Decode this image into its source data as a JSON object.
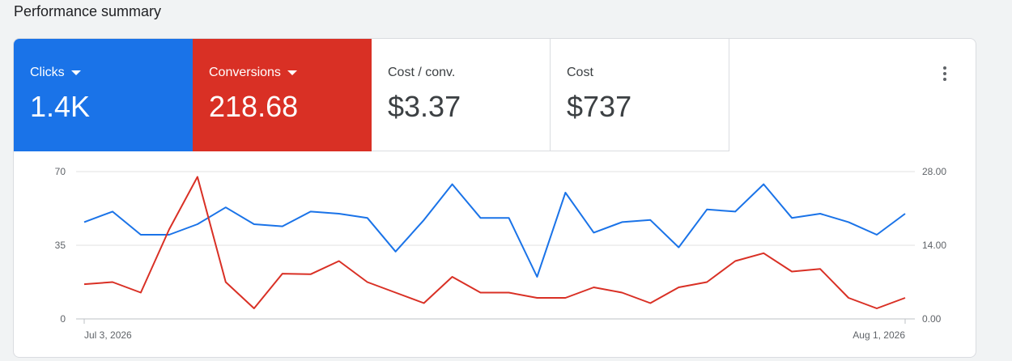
{
  "page": {
    "title": "Performance summary"
  },
  "metrics": [
    {
      "label": "Clicks",
      "value": "1.4K",
      "color": "#1a73e8",
      "has_dropdown": true
    },
    {
      "label": "Conversions",
      "value": "218.68",
      "color": "#d93025",
      "has_dropdown": true
    },
    {
      "label": "Cost / conv.",
      "value": "$3.37",
      "has_dropdown": false
    },
    {
      "label": "Cost",
      "value": "$737",
      "has_dropdown": false
    }
  ],
  "more_button": {
    "icon": "more-vert-icon"
  },
  "chart_data": {
    "type": "line",
    "x_tick_labels": [
      "Jul 3, 2026",
      "Aug 1, 2026"
    ],
    "x": [
      "2026-07-03",
      "2026-07-04",
      "2026-07-05",
      "2026-07-06",
      "2026-07-07",
      "2026-07-08",
      "2026-07-09",
      "2026-07-10",
      "2026-07-11",
      "2026-07-12",
      "2026-07-13",
      "2026-07-14",
      "2026-07-15",
      "2026-07-16",
      "2026-07-17",
      "2026-07-18",
      "2026-07-19",
      "2026-07-20",
      "2026-07-21",
      "2026-07-22",
      "2026-07-23",
      "2026-07-24",
      "2026-07-25",
      "2026-07-26",
      "2026-07-27",
      "2026-07-28",
      "2026-07-29",
      "2026-07-30",
      "2026-07-31",
      "2026-08-01"
    ],
    "series": [
      {
        "name": "Clicks",
        "axis": "left",
        "color": "#1a73e8",
        "values": [
          46,
          51,
          40,
          40,
          45,
          53,
          45,
          44,
          51,
          50,
          48,
          32,
          47,
          64,
          48,
          48,
          20,
          60,
          41,
          46,
          47,
          34,
          52,
          51,
          64,
          48,
          50,
          46,
          40,
          50
        ]
      },
      {
        "name": "Conversions",
        "axis": "right",
        "color": "#d93025",
        "values": [
          6.6,
          7.0,
          5.0,
          17.0,
          27.0,
          7.0,
          2.0,
          8.6,
          8.5,
          11.0,
          7.0,
          5.0,
          3.0,
          8.0,
          5.0,
          5.0,
          4.0,
          4.0,
          6.0,
          5.0,
          3.0,
          6.0,
          7.0,
          11.0,
          12.5,
          9.0,
          9.5,
          4.0,
          2.0,
          4.0
        ]
      }
    ],
    "y_left": {
      "ticks": [
        "0",
        "35",
        "70"
      ],
      "lim": [
        0,
        70
      ]
    },
    "y_right": {
      "ticks": [
        "0.00",
        "14.00",
        "28.00"
      ],
      "lim": [
        0,
        28
      ]
    },
    "grid": true
  }
}
